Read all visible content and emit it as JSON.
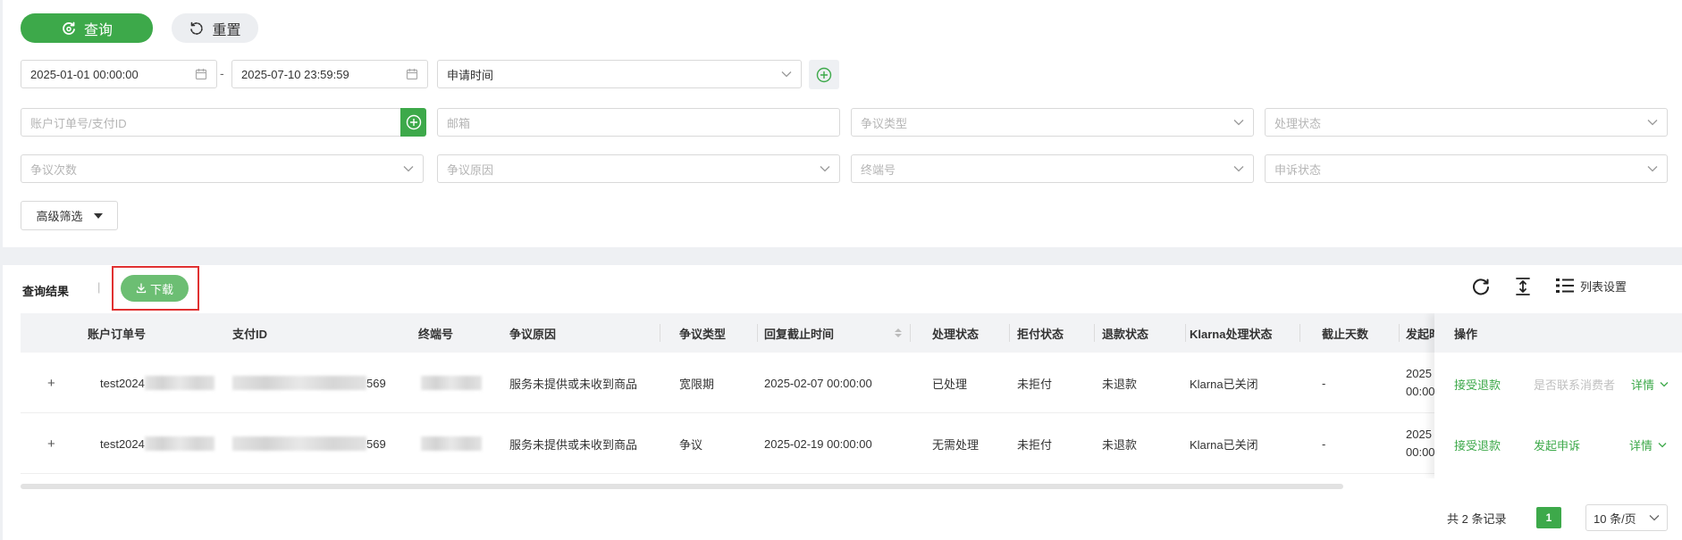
{
  "filters": {
    "query_label": "查询",
    "reset_label": "重置",
    "date_start": "2025-01-01 00:00:00",
    "date_separator": "-",
    "date_end": "2025-07-10 23:59:59",
    "date_type": "申请时间",
    "account_order_placeholder": "账户订单号/支付ID",
    "email_placeholder": "邮箱",
    "dispute_type_placeholder": "争议类型",
    "process_status_placeholder": "处理状态",
    "dispute_count_placeholder": "争议次数",
    "dispute_reason_placeholder": "争议原因",
    "terminal_placeholder": "终端号",
    "appeal_status_placeholder": "申诉状态",
    "advanced_label": "高级筛选"
  },
  "results": {
    "title": "查询结果",
    "separator": "|",
    "download_label": "下载",
    "column_settings_label": "列表设置"
  },
  "table": {
    "headers": {
      "account_order": "账户订单号",
      "payment_id": "支付ID",
      "terminal": "终端号",
      "reason": "争议原因",
      "type": "争议类型",
      "reply_deadline": "回复截止时间",
      "process_status": "处理状态",
      "chargeback_status": "拒付状态",
      "refund_status": "退款状态",
      "klarna_status": "Klarna处理状态",
      "days_left": "截止天数",
      "initiated": "发起时",
      "actions": "操作"
    },
    "rows": [
      {
        "expander": "+",
        "account_order_prefix": "test2024",
        "payment_id_suffix": "569",
        "reason": "服务未提供或未收到商品",
        "type": "宽限期",
        "reply_deadline": "2025-02-07 00:00:00",
        "process_status": "已处理",
        "chargeback_status": "未拒付",
        "refund_status": "未退款",
        "klarna_status": "Klarna已关闭",
        "days_left": "-",
        "initiated_line1": "2025",
        "initiated_line2": "00:00",
        "action_primary": "接受退款",
        "action_secondary": "是否联系消费者",
        "action_detail": "详情"
      },
      {
        "expander": "+",
        "account_order_prefix": "test2024",
        "payment_id_suffix": "569",
        "reason": "服务未提供或未收到商品",
        "type": "争议",
        "reply_deadline": "2025-02-19 00:00:00",
        "process_status": "无需处理",
        "chargeback_status": "未拒付",
        "refund_status": "未退款",
        "klarna_status": "Klarna已关闭",
        "days_left": "-",
        "initiated_line1": "2025",
        "initiated_line2": "00:00",
        "action_primary": "接受退款",
        "action_secondary": "发起申诉",
        "action_detail": "详情"
      }
    ]
  },
  "pagination": {
    "total_text": "共 2 条记录",
    "current_page": "1",
    "page_size": "10 条/页"
  },
  "colors": {
    "primary_green": "#3da94a",
    "download_green": "#6cbe73",
    "highlight_red": "#e03131"
  },
  "icons": {
    "query": "refresh-search-icon",
    "reset": "reset-icon",
    "calendar": "calendar-icon",
    "add": "plus-circle-icon",
    "chevron": "chevron-down-icon",
    "download": "download-icon",
    "refresh": "refresh-icon",
    "density": "density-icon",
    "columns": "list-settings-icon"
  }
}
